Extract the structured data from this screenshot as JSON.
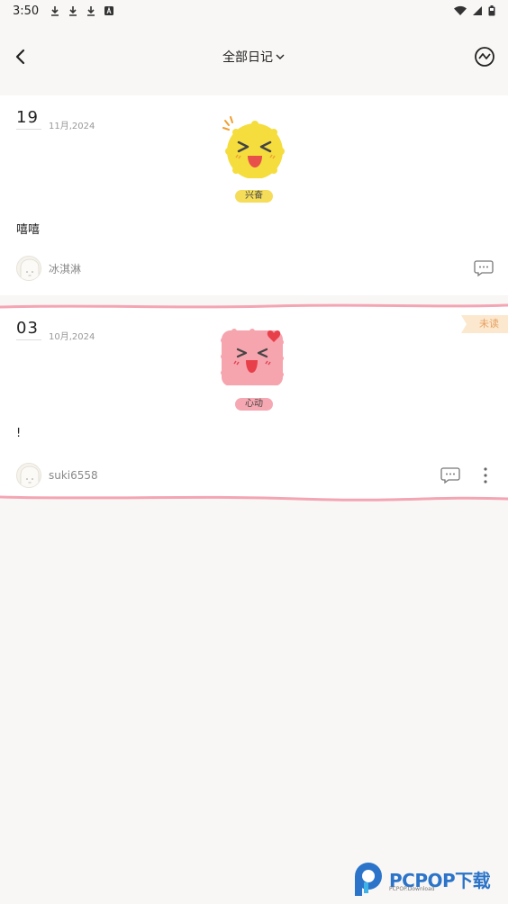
{
  "status_bar": {
    "time": "3:50"
  },
  "header": {
    "title": "全部日记"
  },
  "entries": [
    {
      "day": "19",
      "month_year": "11月,2024",
      "mood": "兴奋",
      "text": "嘻嘻",
      "author": "冰淇淋",
      "unread": ""
    },
    {
      "day": "03",
      "month_year": "10月,2024",
      "mood": "心动",
      "text": "!",
      "author": "suki6558",
      "unread": "未读"
    }
  ],
  "watermark": {
    "brand": "PCPOP下载",
    "sub": "PCPOP.Download"
  },
  "colors": {
    "background": "#f8f7f5",
    "yellow_mood": "#f5dd5a",
    "pink_mood": "#f6a8b2",
    "pink_border": "#f4a5b3",
    "unread": "#e8a060"
  }
}
